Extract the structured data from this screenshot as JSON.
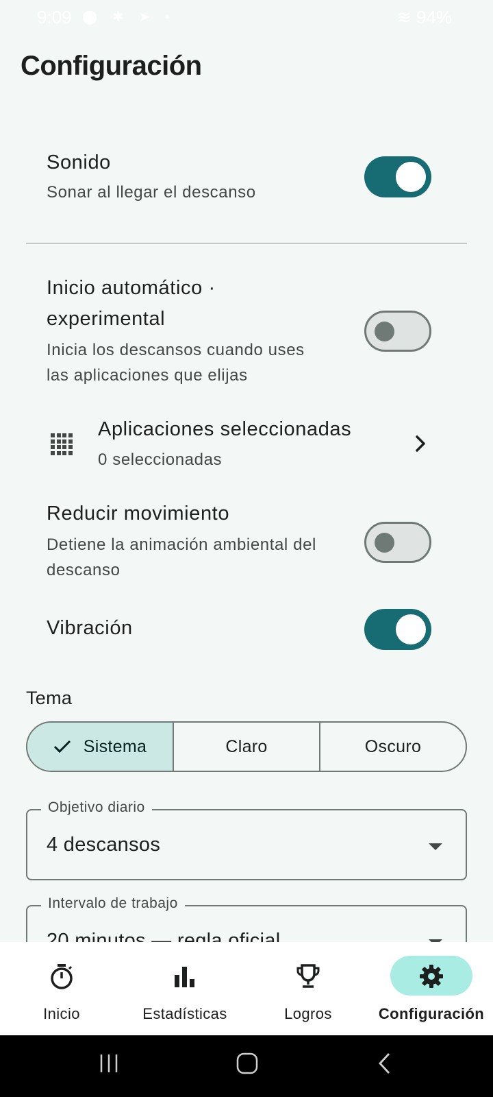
{
  "status_bar": {
    "time": "9:09",
    "battery": "94%"
  },
  "page": {
    "title": "Configuración"
  },
  "settings": {
    "sound": {
      "title": "Sonido",
      "subtitle": "Sonar al llegar el descanso",
      "enabled": true
    },
    "auto_start": {
      "title_line1": "Inicio automático ·",
      "title_line2": "experimental",
      "subtitle_line1": "Inicia los descansos cuando uses",
      "subtitle_line2": "las aplicaciones que elijas",
      "enabled": false
    },
    "selected_apps": {
      "title": "Aplicaciones seleccionadas",
      "subtitle": "0 seleccionadas",
      "icon": "apps-grid-icon"
    },
    "reduce_motion": {
      "title": "Reducir movimiento",
      "subtitle_line1": "Detiene la animación ambiental del",
      "subtitle_line2": "descanso",
      "enabled": false
    },
    "vibration": {
      "title": "Vibración",
      "enabled": true
    }
  },
  "theme": {
    "label": "Tema",
    "options": [
      "Sistema",
      "Claro",
      "Oscuro"
    ],
    "selected": "Sistema"
  },
  "daily_goal": {
    "label": "Objetivo diario",
    "value": "4 descansos"
  },
  "work_interval": {
    "label": "Intervalo de trabajo",
    "value": "20 minutos — regla oficial"
  },
  "bottom_nav": {
    "items": [
      {
        "label": "Inicio",
        "icon": "timer-icon"
      },
      {
        "label": "Estadísticas",
        "icon": "bar-chart-icon"
      },
      {
        "label": "Logros",
        "icon": "trophy-icon"
      },
      {
        "label": "Configuración",
        "icon": "gear-icon"
      }
    ],
    "active": "Configuración"
  },
  "colors": {
    "accent": "#176b72",
    "active_pill": "#a8ece3",
    "selected_segment": "#cce8e5",
    "background": "#f3f7f6"
  }
}
